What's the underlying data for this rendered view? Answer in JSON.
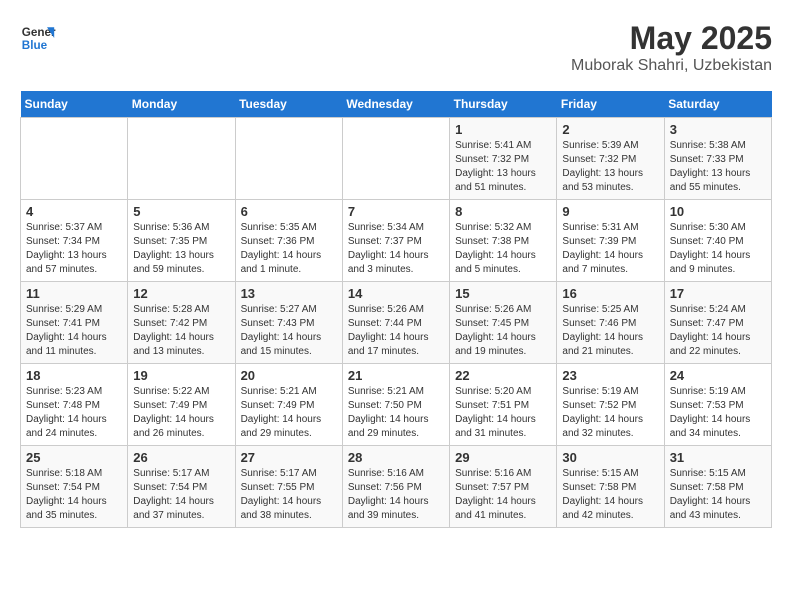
{
  "logo": {
    "line1": "General",
    "line2": "Blue"
  },
  "title": "May 2025",
  "location": "Muborak Shahri, Uzbekistan",
  "weekdays": [
    "Sunday",
    "Monday",
    "Tuesday",
    "Wednesday",
    "Thursday",
    "Friday",
    "Saturday"
  ],
  "weeks": [
    [
      {
        "day": "",
        "info": ""
      },
      {
        "day": "",
        "info": ""
      },
      {
        "day": "",
        "info": ""
      },
      {
        "day": "",
        "info": ""
      },
      {
        "day": "1",
        "info": "Sunrise: 5:41 AM\nSunset: 7:32 PM\nDaylight: 13 hours\nand 51 minutes."
      },
      {
        "day": "2",
        "info": "Sunrise: 5:39 AM\nSunset: 7:32 PM\nDaylight: 13 hours\nand 53 minutes."
      },
      {
        "day": "3",
        "info": "Sunrise: 5:38 AM\nSunset: 7:33 PM\nDaylight: 13 hours\nand 55 minutes."
      }
    ],
    [
      {
        "day": "4",
        "info": "Sunrise: 5:37 AM\nSunset: 7:34 PM\nDaylight: 13 hours\nand 57 minutes."
      },
      {
        "day": "5",
        "info": "Sunrise: 5:36 AM\nSunset: 7:35 PM\nDaylight: 13 hours\nand 59 minutes."
      },
      {
        "day": "6",
        "info": "Sunrise: 5:35 AM\nSunset: 7:36 PM\nDaylight: 14 hours\nand 1 minute."
      },
      {
        "day": "7",
        "info": "Sunrise: 5:34 AM\nSunset: 7:37 PM\nDaylight: 14 hours\nand 3 minutes."
      },
      {
        "day": "8",
        "info": "Sunrise: 5:32 AM\nSunset: 7:38 PM\nDaylight: 14 hours\nand 5 minutes."
      },
      {
        "day": "9",
        "info": "Sunrise: 5:31 AM\nSunset: 7:39 PM\nDaylight: 14 hours\nand 7 minutes."
      },
      {
        "day": "10",
        "info": "Sunrise: 5:30 AM\nSunset: 7:40 PM\nDaylight: 14 hours\nand 9 minutes."
      }
    ],
    [
      {
        "day": "11",
        "info": "Sunrise: 5:29 AM\nSunset: 7:41 PM\nDaylight: 14 hours\nand 11 minutes."
      },
      {
        "day": "12",
        "info": "Sunrise: 5:28 AM\nSunset: 7:42 PM\nDaylight: 14 hours\nand 13 minutes."
      },
      {
        "day": "13",
        "info": "Sunrise: 5:27 AM\nSunset: 7:43 PM\nDaylight: 14 hours\nand 15 minutes."
      },
      {
        "day": "14",
        "info": "Sunrise: 5:26 AM\nSunset: 7:44 PM\nDaylight: 14 hours\nand 17 minutes."
      },
      {
        "day": "15",
        "info": "Sunrise: 5:26 AM\nSunset: 7:45 PM\nDaylight: 14 hours\nand 19 minutes."
      },
      {
        "day": "16",
        "info": "Sunrise: 5:25 AM\nSunset: 7:46 PM\nDaylight: 14 hours\nand 21 minutes."
      },
      {
        "day": "17",
        "info": "Sunrise: 5:24 AM\nSunset: 7:47 PM\nDaylight: 14 hours\nand 22 minutes."
      }
    ],
    [
      {
        "day": "18",
        "info": "Sunrise: 5:23 AM\nSunset: 7:48 PM\nDaylight: 14 hours\nand 24 minutes."
      },
      {
        "day": "19",
        "info": "Sunrise: 5:22 AM\nSunset: 7:49 PM\nDaylight: 14 hours\nand 26 minutes."
      },
      {
        "day": "20",
        "info": "Sunrise: 5:21 AM\nSunset: 7:49 PM\nDaylight: 14 hours\nand 29 minutes."
      },
      {
        "day": "21",
        "info": "Sunrise: 5:21 AM\nSunset: 7:50 PM\nDaylight: 14 hours\nand 29 minutes."
      },
      {
        "day": "22",
        "info": "Sunrise: 5:20 AM\nSunset: 7:51 PM\nDaylight: 14 hours\nand 31 minutes."
      },
      {
        "day": "23",
        "info": "Sunrise: 5:19 AM\nSunset: 7:52 PM\nDaylight: 14 hours\nand 32 minutes."
      },
      {
        "day": "24",
        "info": "Sunrise: 5:19 AM\nSunset: 7:53 PM\nDaylight: 14 hours\nand 34 minutes."
      }
    ],
    [
      {
        "day": "25",
        "info": "Sunrise: 5:18 AM\nSunset: 7:54 PM\nDaylight: 14 hours\nand 35 minutes."
      },
      {
        "day": "26",
        "info": "Sunrise: 5:17 AM\nSunset: 7:54 PM\nDaylight: 14 hours\nand 37 minutes."
      },
      {
        "day": "27",
        "info": "Sunrise: 5:17 AM\nSunset: 7:55 PM\nDaylight: 14 hours\nand 38 minutes."
      },
      {
        "day": "28",
        "info": "Sunrise: 5:16 AM\nSunset: 7:56 PM\nDaylight: 14 hours\nand 39 minutes."
      },
      {
        "day": "29",
        "info": "Sunrise: 5:16 AM\nSunset: 7:57 PM\nDaylight: 14 hours\nand 41 minutes."
      },
      {
        "day": "30",
        "info": "Sunrise: 5:15 AM\nSunset: 7:58 PM\nDaylight: 14 hours\nand 42 minutes."
      },
      {
        "day": "31",
        "info": "Sunrise: 5:15 AM\nSunset: 7:58 PM\nDaylight: 14 hours\nand 43 minutes."
      }
    ]
  ]
}
